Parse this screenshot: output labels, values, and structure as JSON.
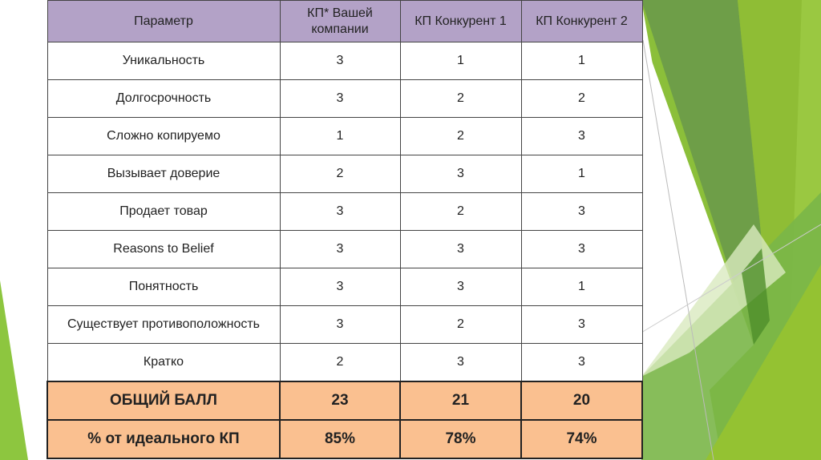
{
  "table": {
    "headers": [
      "Параметр",
      "КП* Вашей компании",
      "КП Конкурент 1",
      "КП Конкурент 2"
    ],
    "rows": [
      [
        "Уникальность",
        "3",
        "1",
        "1"
      ],
      [
        "Долгосрочность",
        "3",
        "2",
        "2"
      ],
      [
        "Сложно копируемо",
        "1",
        "2",
        "3"
      ],
      [
        "Вызывает доверие",
        "2",
        "3",
        "1"
      ],
      [
        "Продает товар",
        "3",
        "2",
        "3"
      ],
      [
        "Reasons to Belief",
        "3",
        "3",
        "3"
      ],
      [
        "Понятность",
        "3",
        "3",
        "1"
      ],
      [
        "Существует противоположность",
        "3",
        "2",
        "3"
      ],
      [
        "Кратко",
        "2",
        "3",
        "3"
      ]
    ],
    "totals": [
      [
        "ОБЩИЙ БАЛЛ",
        "23",
        "21",
        "20"
      ],
      [
        "% от идеального КП",
        "85%",
        "78%",
        "74%"
      ]
    ]
  },
  "colors": {
    "header_bg": "#b3a2c7",
    "total_bg": "#fac090",
    "accent_green": "#8dc63f"
  }
}
